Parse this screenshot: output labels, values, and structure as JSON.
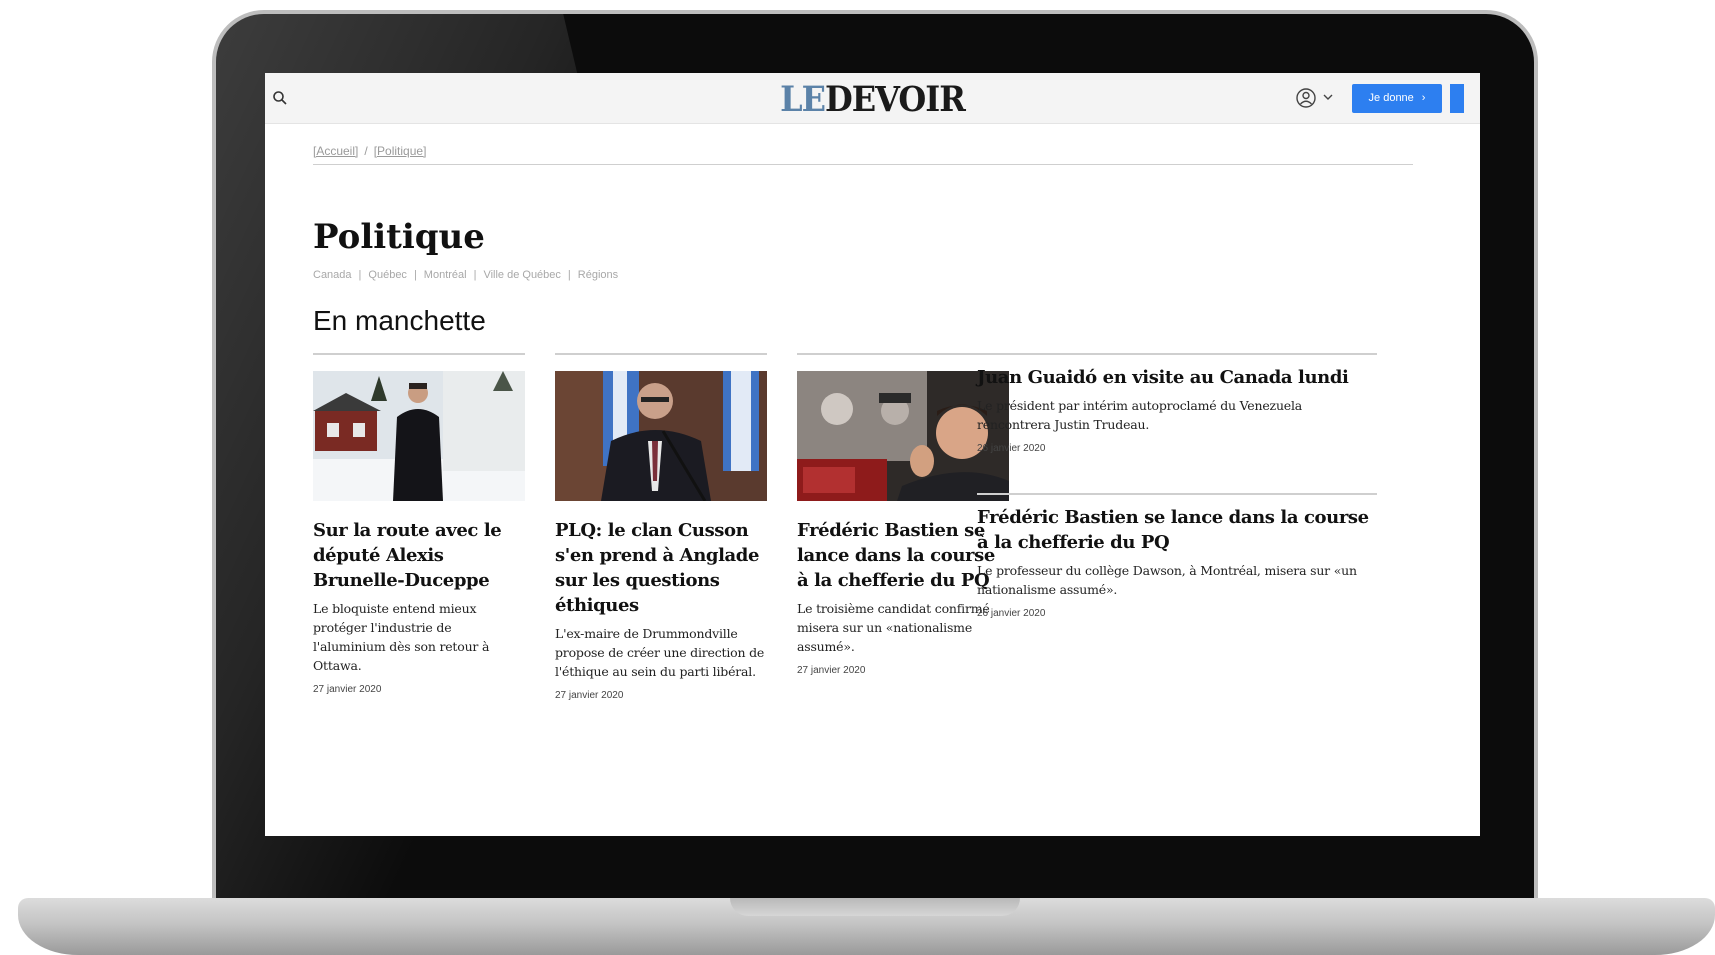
{
  "header": {
    "logo_le": "LE",
    "logo_devoir": "DEVOIR",
    "donate_label": "Je donne",
    "donate_arrow": "›",
    "brand_color": "#2d7ff0",
    "icons": [
      "search-icon",
      "account-icon",
      "chevron-down-icon"
    ]
  },
  "breadcrumb": {
    "home": "[Accueil]",
    "separator": "/",
    "current": "[Politique]"
  },
  "page": {
    "title": "Politique",
    "subnav": [
      "Canada",
      "Québec",
      "Montréal",
      "Ville de Québec",
      "Régions"
    ],
    "section_title": "En manchette"
  },
  "articles": [
    {
      "title": "Sur la route avec le député Alexis Brunelle-Duceppe",
      "summary": "Le bloquiste entend mieux protéger l'industrie de l'aluminium dès son retour à Ottawa.",
      "date": "27 janvier 2020"
    },
    {
      "title": "PLQ: le clan Cusson s'en prend à Anglade sur les questions éthiques",
      "summary": "L'ex-maire de Drummondville propose de créer une direction de l'éthique au sein du parti libéral.",
      "date": "27 janvier 2020"
    },
    {
      "title": "Frédéric Bastien se lance dans la course à la chefferie du PQ",
      "summary": "Le troisième candidat confirmé misera sur un «nationalisme assumé».",
      "date": "27 janvier 2020"
    }
  ],
  "side_articles": [
    {
      "title": "Juan Guaidó en visite au Canada lundi",
      "summary": "Le président par intérim autoproclamé du Venezuela rencontrera Justin Trudeau.",
      "date": "26 janvier 2020"
    },
    {
      "title": "Frédéric Bastien se lance dans la course à la chefferie du PQ",
      "summary": "Le professeur du collège Dawson, à Montréal, misera sur «un nationalisme assumé».",
      "date": "26 janvier 2020"
    }
  ]
}
